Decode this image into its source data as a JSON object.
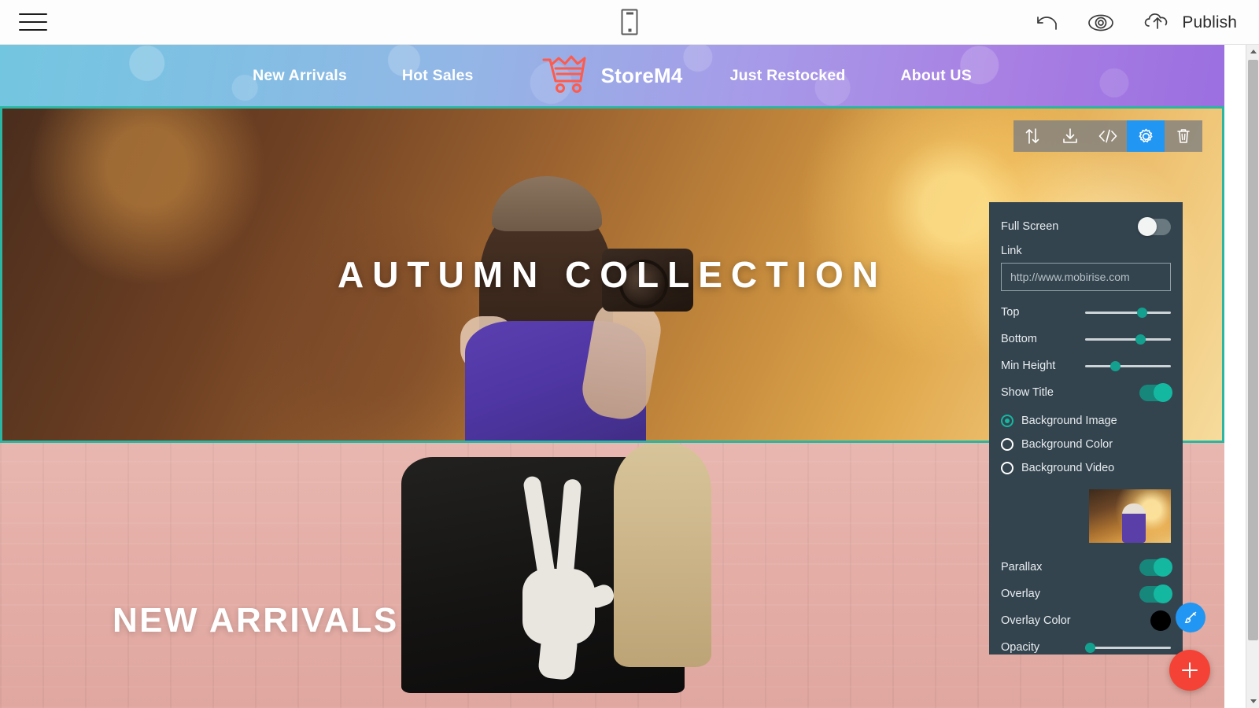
{
  "appbar": {
    "menu_icon": "hamburger-icon",
    "device_preview_icon": "mobile-phone-icon",
    "undo_icon": "undo-arrow-icon",
    "preview_icon": "eye-icon",
    "publish_icon": "cloud-upload-icon",
    "publish_label": "Publish"
  },
  "site": {
    "nav": {
      "links_left": [
        "New Arrivals",
        "Hot Sales"
      ],
      "brand": "StoreM4",
      "brand_icon": "shopping-cart-icon",
      "links_right": [
        "Just Restocked",
        "About US"
      ]
    },
    "hero": {
      "title": "AUTUMN COLLECTION"
    },
    "section_two": {
      "title": "NEW ARRIVALS"
    }
  },
  "block_toolbar": {
    "buttons": [
      {
        "name": "move-block",
        "icon": "up-down-arrows-icon",
        "active": false
      },
      {
        "name": "download-block",
        "icon": "download-icon",
        "active": false
      },
      {
        "name": "edit-code",
        "icon": "code-brackets-icon",
        "active": false
      },
      {
        "name": "block-settings",
        "icon": "gear-icon",
        "active": true
      },
      {
        "name": "delete-block",
        "icon": "trash-icon",
        "active": false
      }
    ],
    "active_color": "#2196f3"
  },
  "settings": {
    "full_screen": {
      "label": "Full Screen",
      "state": "off"
    },
    "link": {
      "label": "Link",
      "placeholder": "http://www.mobirise.com",
      "value": ""
    },
    "sliders": [
      {
        "label": "Top",
        "percent": 64
      },
      {
        "label": "Bottom",
        "percent": 62
      },
      {
        "label": "Min Height",
        "percent": 32
      }
    ],
    "show_title": {
      "label": "Show Title",
      "state": "on"
    },
    "background_options": [
      {
        "label": "Background Image",
        "selected": true
      },
      {
        "label": "Background Color",
        "selected": false
      },
      {
        "label": "Background Video",
        "selected": false
      }
    ],
    "background_thumbnail": "autumn-forest-photo",
    "parallax": {
      "label": "Parallax",
      "state": "on"
    },
    "overlay": {
      "label": "Overlay",
      "state": "on"
    },
    "overlay_color": {
      "label": "Overlay Color",
      "value": "#000000"
    },
    "opacity": {
      "label": "Opacity",
      "percent": 3
    },
    "accent_color": "#14b8a0",
    "panel_color": "#33444f"
  },
  "fabs": {
    "brush": {
      "name": "brush-icon",
      "color": "#2196f3"
    },
    "add": {
      "name": "plus-icon",
      "color": "#f44336"
    }
  },
  "selection": {
    "border_color": "#2bb6a3"
  }
}
